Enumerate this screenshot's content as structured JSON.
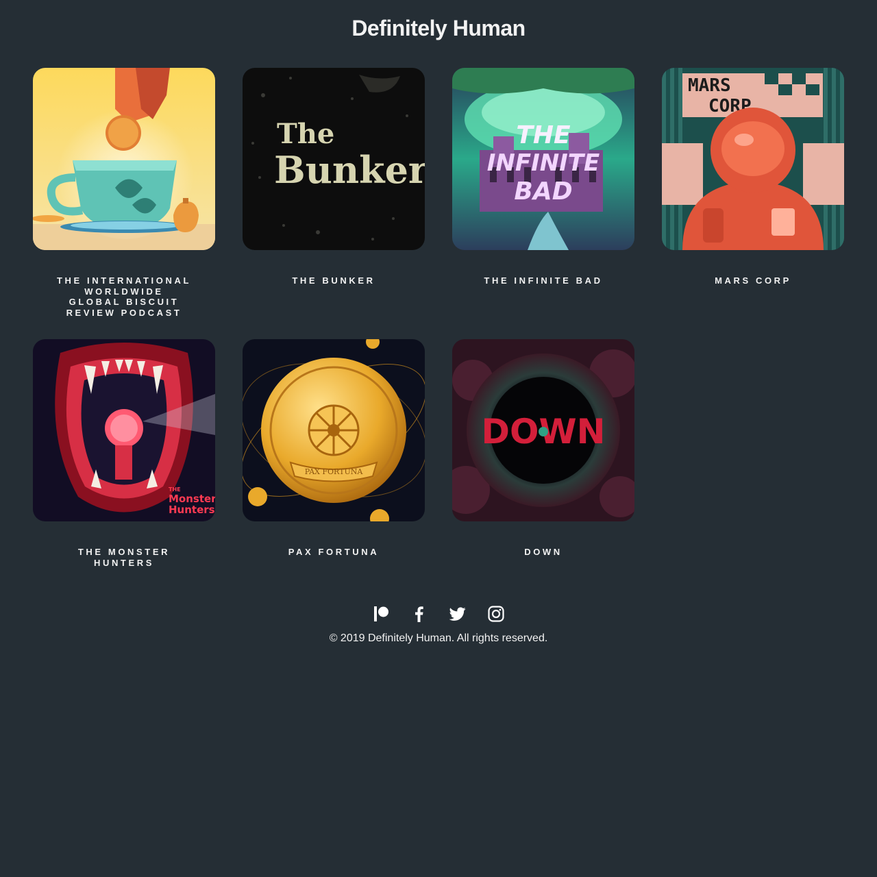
{
  "site": {
    "title": "Definitely Human"
  },
  "podcasts": [
    {
      "title": "THE INTERNATIONAL WORLDWIDE GLOBAL BISCUIT REVIEW PODCAST",
      "art_name": "biscuit-review-cover"
    },
    {
      "title": "THE BUNKER",
      "art_name": "the-bunker-cover",
      "art_text": [
        "The",
        "Bunker"
      ]
    },
    {
      "title": "THE INFINITE BAD",
      "art_name": "infinite-bad-cover",
      "art_text": [
        "THE",
        "INFINITE",
        "BAD"
      ]
    },
    {
      "title": "MARS CORP",
      "art_name": "mars-corp-cover",
      "art_text": [
        "MARS",
        "CORP"
      ]
    },
    {
      "title": "THE MONSTER HUNTERS",
      "art_name": "monster-hunters-cover",
      "art_text": [
        "THE",
        "Monster",
        "Hunters"
      ]
    },
    {
      "title": "PAX FORTUNA",
      "art_name": "pax-fortuna-cover",
      "art_text": [
        "PAX FORTUNA"
      ]
    },
    {
      "title": "DOWN",
      "art_name": "down-cover",
      "art_text": [
        "DOWN"
      ]
    }
  ],
  "footer": {
    "socials": [
      {
        "name": "patreon-icon",
        "label": "Patreon"
      },
      {
        "name": "facebook-icon",
        "label": "Facebook"
      },
      {
        "name": "twitter-icon",
        "label": "Twitter"
      },
      {
        "name": "instagram-icon",
        "label": "Instagram"
      }
    ],
    "copyright": "© 2019 Definitely Human. All rights reserved."
  },
  "colors": {
    "background": "#252e35",
    "text": "#f2f2f2"
  }
}
